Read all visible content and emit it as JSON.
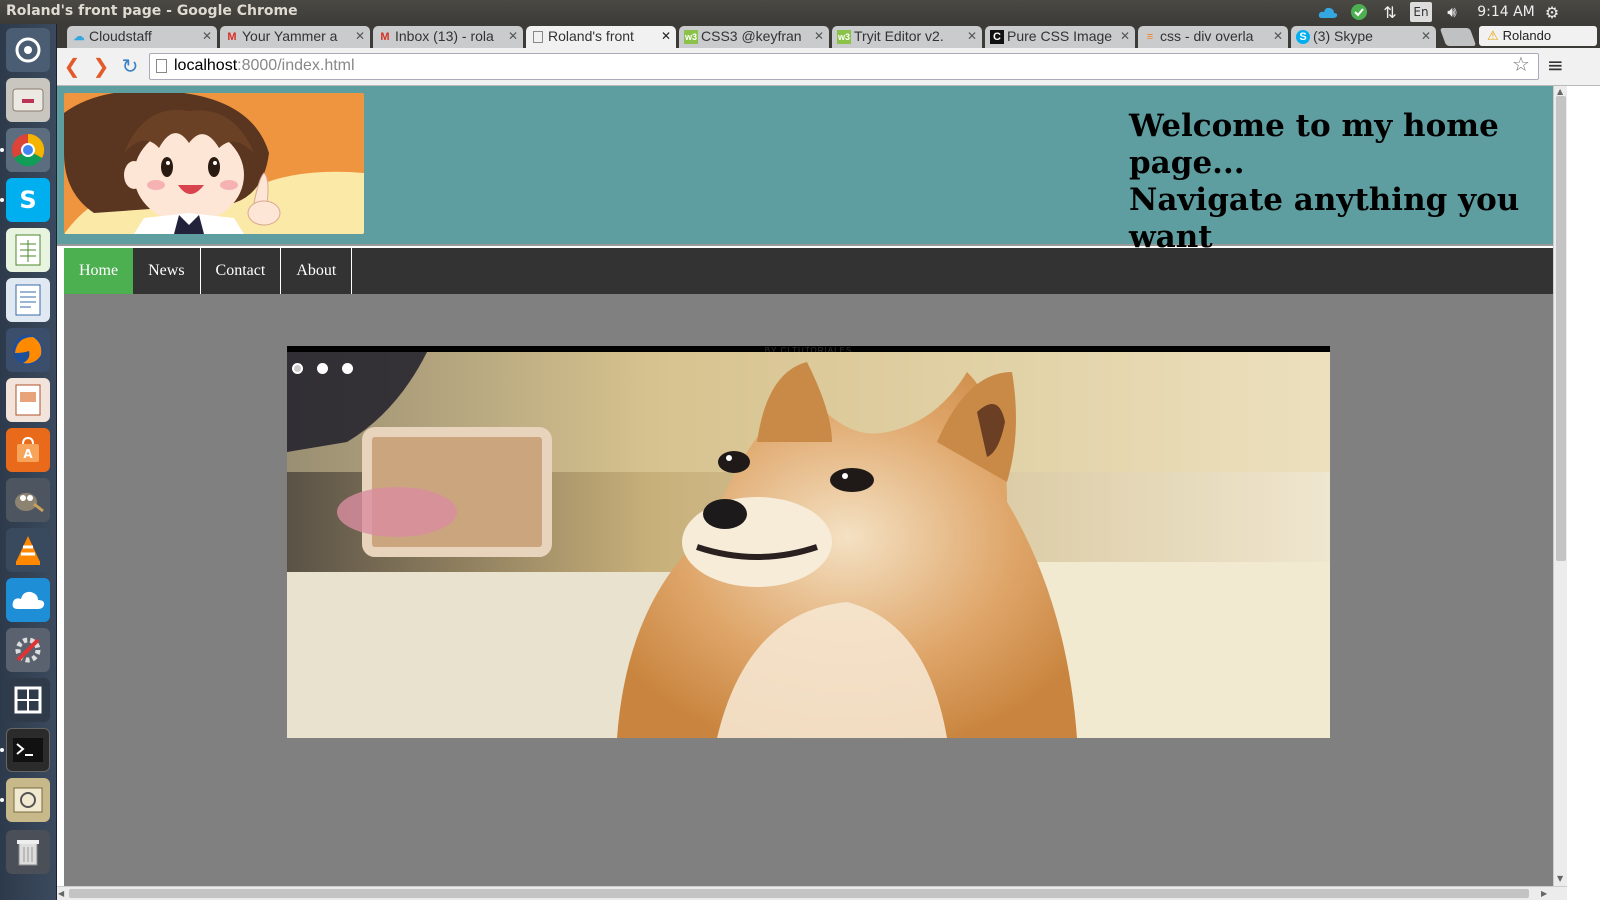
{
  "window": {
    "title": "Roland's front page - Google Chrome"
  },
  "tray": {
    "keyboard": "En",
    "time": "9:14 AM"
  },
  "launcher": {
    "items": [
      "dash-icon",
      "files-icon",
      "chrome-icon",
      "skype-icon",
      "spreadsheet-icon",
      "document-icon",
      "firefox-icon",
      "presentation-icon",
      "software-center-icon",
      "gimp-icon",
      "vlc-icon",
      "cloud-icon",
      "settings-icon",
      "workspace-icon",
      "terminal-icon",
      "image-viewer-icon",
      "trash-icon"
    ],
    "colors": {
      "panel": "#3c3b37",
      "launcher": "#2d3a4b"
    }
  },
  "browser": {
    "tabs": [
      {
        "label": "Cloudstaff",
        "icon": "cloud-icon"
      },
      {
        "label": "Your Yammer a",
        "icon": "gmail-icon"
      },
      {
        "label": "Inbox (13) - rola",
        "icon": "gmail-icon"
      },
      {
        "label": "Roland's front",
        "icon": "page-icon",
        "active": true
      },
      {
        "label": "CSS3 @keyfran",
        "icon": "w3-icon"
      },
      {
        "label": "Tryit Editor v2.",
        "icon": "w3-icon"
      },
      {
        "label": "Pure CSS Image",
        "icon": "codepen-icon"
      },
      {
        "label": "css - div overla",
        "icon": "stackoverflow-icon"
      },
      {
        "label": "(3) Skype",
        "icon": "skype-icon"
      }
    ],
    "profile": "Rolando",
    "url": {
      "host": "localhost",
      "path": ":8000/index.html"
    }
  },
  "site": {
    "header_line1": "Welcome to my home page...",
    "header_line2": "Navigate anything you want",
    "nav": [
      {
        "label": "Home",
        "active": true
      },
      {
        "label": "News"
      },
      {
        "label": "Contact"
      },
      {
        "label": "About"
      }
    ],
    "slider_credit": "BY CLTUTORIALES",
    "slider_dots": 3,
    "colors": {
      "header": "#5f9ea0",
      "nav": "#333333",
      "nav_active": "#4caf50",
      "content": "#808080"
    }
  }
}
